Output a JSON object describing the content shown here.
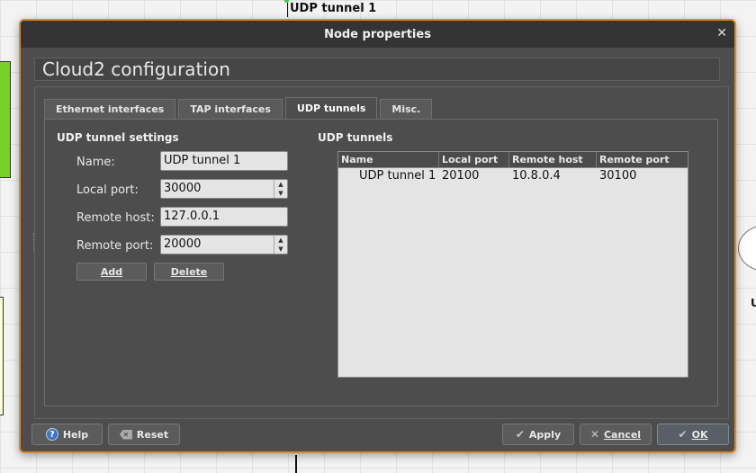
{
  "canvas": {
    "link_label": "UDP tunnel 1",
    "partial_node_label": "U"
  },
  "dialog": {
    "title": "Node properties",
    "close_glyph": "✕",
    "config_title": "Cloud2 configuration",
    "tabs": [
      {
        "label": "Ethernet interfaces",
        "active": false
      },
      {
        "label": "TAP interfaces",
        "active": false
      },
      {
        "label": "UDP tunnels",
        "active": true
      },
      {
        "label": "Misc.",
        "active": false
      }
    ],
    "settings": {
      "heading": "UDP tunnel settings",
      "name_label": "Name:",
      "name_value": "UDP tunnel 1",
      "local_port_label": "Local port:",
      "local_port_value": "30000",
      "remote_host_label": "Remote host:",
      "remote_host_value": "127.0.0.1",
      "remote_port_label": "Remote port:",
      "remote_port_value": "20000",
      "add_label": "Add",
      "delete_label": "Delete"
    },
    "tunnels": {
      "heading": "UDP tunnels",
      "columns": [
        "Name",
        "Local port",
        "Remote host",
        "Remote port"
      ],
      "rows": [
        [
          "UDP tunnel 1",
          "20100",
          "10.8.0.4",
          "30100"
        ]
      ]
    },
    "buttons": {
      "help": "Help",
      "reset": "Reset",
      "apply": "Apply",
      "cancel": "Cancel",
      "ok": "OK"
    },
    "colors": {
      "accent_border": "#d8892e",
      "dialog_bg": "#4d4d4d",
      "titlebar_bg": "#343434"
    }
  }
}
